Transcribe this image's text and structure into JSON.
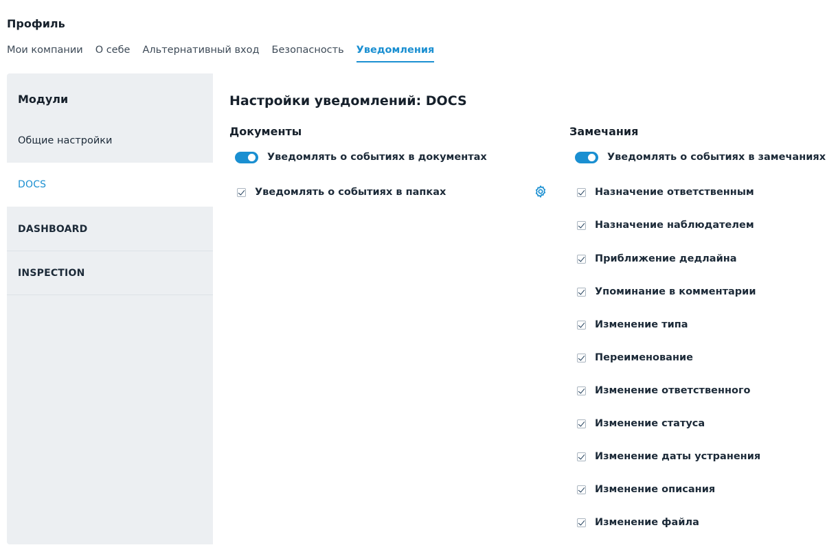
{
  "header": {
    "title": "Профиль",
    "tabs": [
      {
        "label": "Мои компании",
        "active": false
      },
      {
        "label": "О себе",
        "active": false
      },
      {
        "label": "Альтернативный вход",
        "active": false
      },
      {
        "label": "Безопасность",
        "active": false
      },
      {
        "label": "Уведомления",
        "active": true
      }
    ]
  },
  "sidebar": {
    "heading": "Модули",
    "items": [
      {
        "label": "Общие настройки",
        "active": false
      },
      {
        "label": "DOCS",
        "active": true
      },
      {
        "label": "DASHBOARD",
        "active": false
      },
      {
        "label": "INSPECTION",
        "active": false
      }
    ]
  },
  "main": {
    "title": "Настройки уведомлений: DOCS",
    "documents": {
      "title": "Документы",
      "toggle_label": "Уведомлять о событиях в документах",
      "toggle_on": true,
      "options": [
        {
          "label": "Уведомлять о событиях в папках",
          "checked": true,
          "icon": "gear-icon"
        }
      ]
    },
    "remarks": {
      "title": "Замечания",
      "toggle_label": "Уведомлять о событиях в замечаниях",
      "toggle_on": true,
      "options": [
        {
          "label": "Назначение ответственным",
          "checked": true
        },
        {
          "label": "Назначение наблюдателем",
          "checked": true
        },
        {
          "label": "Приближение дедлайна",
          "checked": true
        },
        {
          "label": "Упоминание в комментарии",
          "checked": true
        },
        {
          "label": "Изменение типа",
          "checked": true
        },
        {
          "label": "Переименование",
          "checked": true
        },
        {
          "label": "Изменение ответственного",
          "checked": true
        },
        {
          "label": "Изменение статуса",
          "checked": true
        },
        {
          "label": "Изменение даты устранения",
          "checked": true
        },
        {
          "label": "Изменение описания",
          "checked": true
        },
        {
          "label": "Изменение файла",
          "checked": true
        }
      ]
    }
  },
  "colors": {
    "accent": "#1a8fd1",
    "sidebar_bg": "#eceff2",
    "text": "#1c2a38"
  }
}
